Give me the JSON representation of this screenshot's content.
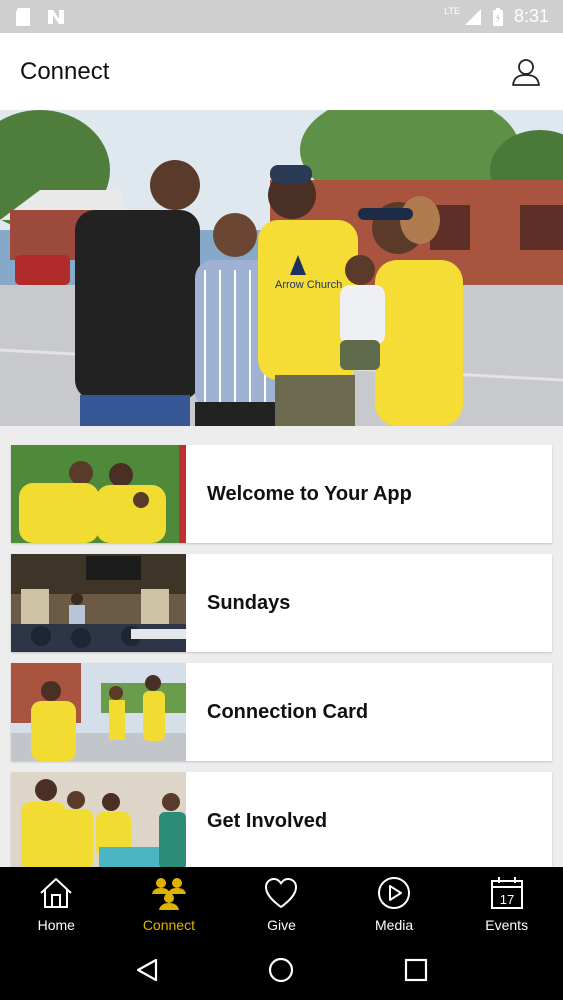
{
  "status_bar": {
    "network": "LTE",
    "time": "8:31"
  },
  "header": {
    "title": "Connect"
  },
  "list_items": [
    {
      "label": "Welcome to Your App"
    },
    {
      "label": "Sundays"
    },
    {
      "label": "Connection Card"
    },
    {
      "label": "Get Involved"
    }
  ],
  "tabs": [
    {
      "label": "Home",
      "icon": "home-icon"
    },
    {
      "label": "Connect",
      "icon": "connect-icon",
      "active": true
    },
    {
      "label": "Give",
      "icon": "heart-icon"
    },
    {
      "label": "Media",
      "icon": "play-icon"
    },
    {
      "label": "Events",
      "icon": "calendar-icon",
      "date": "17"
    }
  ],
  "hero_shirt_text": "Arrow Church",
  "colors": {
    "accent": "#e0b300",
    "tab_bar": "#000000",
    "header": "#ffffff",
    "background": "#ededed"
  }
}
